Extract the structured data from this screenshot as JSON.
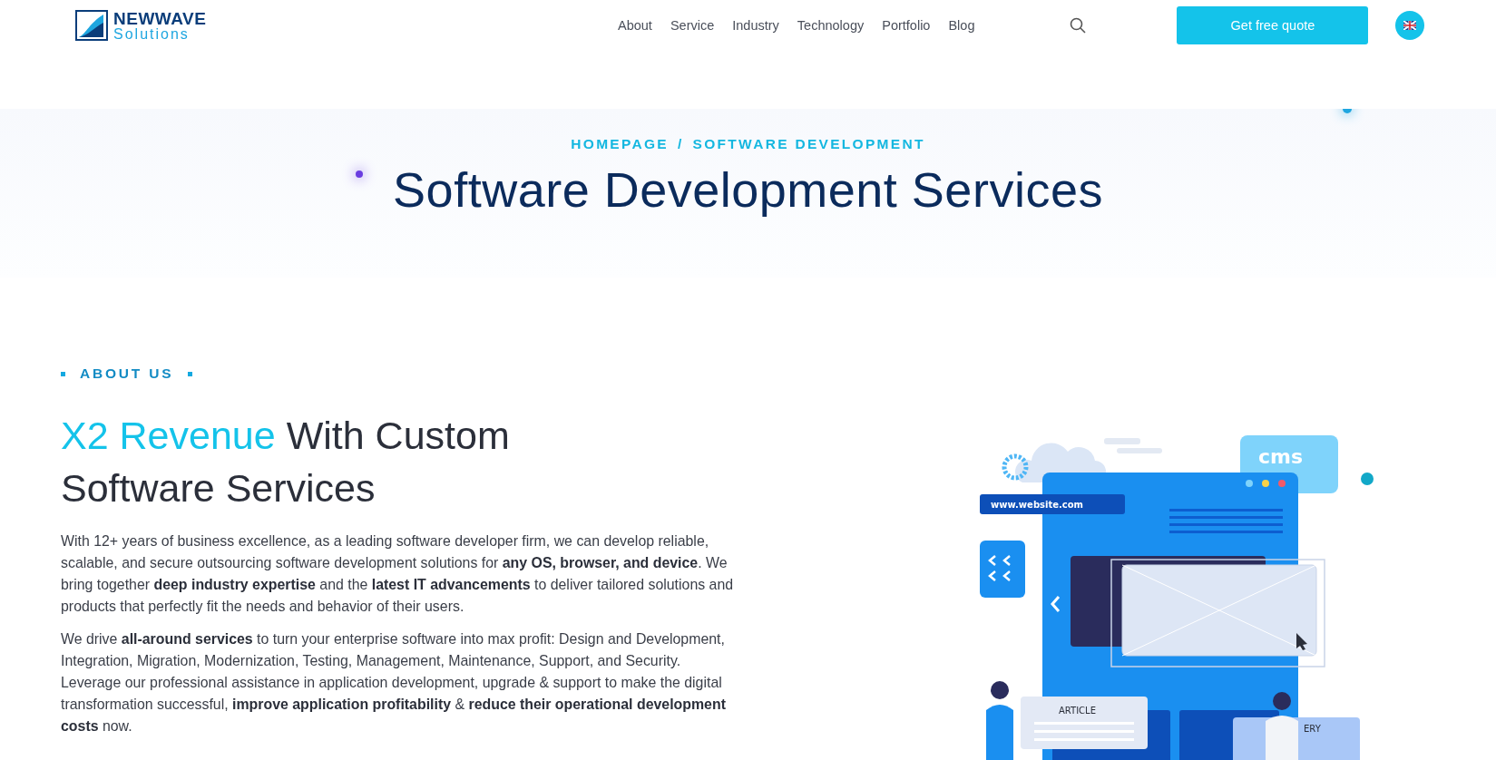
{
  "header": {
    "logo": {
      "name": "NEWWAVE",
      "tagline": "Solutions"
    },
    "nav": [
      {
        "label": "About"
      },
      {
        "label": "Service"
      },
      {
        "label": "Industry"
      },
      {
        "label": "Technology"
      },
      {
        "label": "Portfolio"
      },
      {
        "label": "Blog"
      }
    ],
    "cta": "Get free quote"
  },
  "hero": {
    "breadcrumb": [
      {
        "label": "HOMEPAGE"
      },
      {
        "label": "SOFTWARE DEVELOPMENT"
      }
    ],
    "separator": "/",
    "title": "Software Development Services"
  },
  "about": {
    "eyebrow": "ABOUT US",
    "heading_highlight": "X2 Revenue",
    "heading_rest": "With Custom Software Services",
    "paragraphs": [
      "With 12+ years of business excellence, as a leading software developer firm, we can develop reliable, scalable, and secure outsourcing software development solutions for **any OS, browser, and device**. We bring together **deep industry expertise** and the **latest IT advancements** to deliver tailored solutions and products that perfectly fit the needs and behavior of their users.",
      "We drive **all-around services** to turn your enterprise software into max profit: Design and Development, Integration, Migration, Modernization, Testing, Management, Maintenance, Support, and Security. Leverage our professional assistance in application development, upgrade & support to make the digital transformation successful, **improve application profitability** & **reduce their operational development costs** now."
    ]
  },
  "illustration": {
    "url": "www.website.com",
    "cms": "cms",
    "article": "ARTICLE",
    "gallery": "ERY"
  }
}
